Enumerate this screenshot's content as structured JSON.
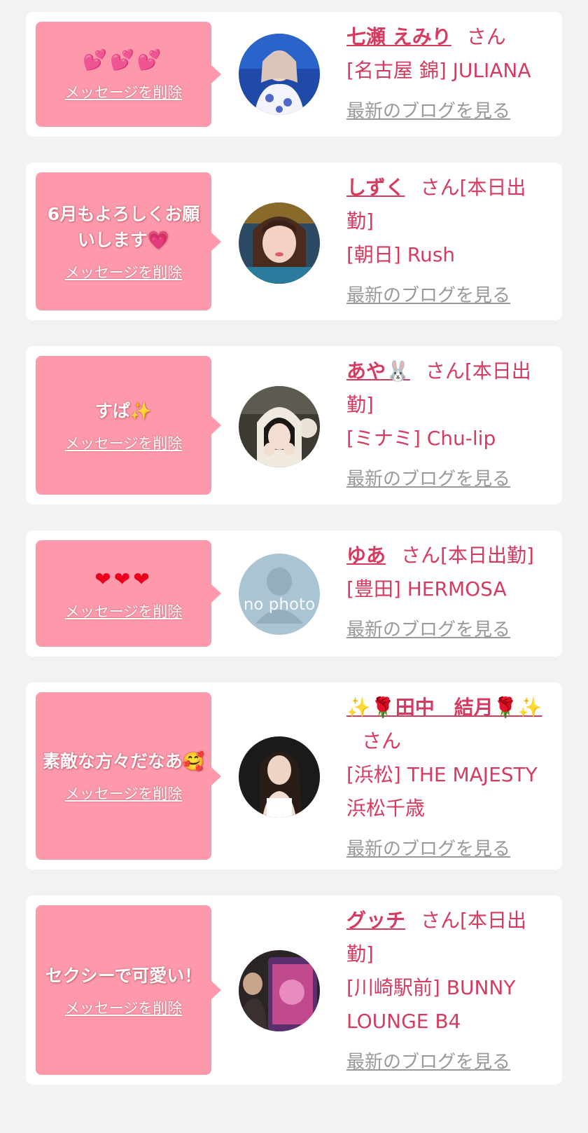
{
  "delete_label": "メッセージを削除",
  "blog_label": "最新のブログを見る",
  "items": [
    {
      "message": "",
      "message_icons": "💕💕💕",
      "name": "七瀬 えみり",
      "suffix": "さん",
      "shop": "[名古屋 錦] JULIANA"
    },
    {
      "message": "6月もよろしくお願いします💗",
      "name": "しずく",
      "suffix": "さん[本日出勤]",
      "shop": "[朝日] Rush"
    },
    {
      "message": "すぱ✨",
      "name": "あや🐰",
      "suffix": "さん[本日出勤]",
      "shop": "[ミナミ] Chu-lip"
    },
    {
      "message": "",
      "message_icons": "❤❤❤",
      "name": "ゆあ",
      "suffix": "さん[本日出勤]",
      "shop": "[豊田] HERMOSA",
      "no_photo_label": "no photo"
    },
    {
      "message": "素敵な方々だなあ🥰",
      "name": "✨🌹田中　結月🌹✨",
      "suffix": "さん",
      "shop": "[浜松] THE MAJESTY 浜松千歳"
    },
    {
      "message": "セクシーで可愛い！",
      "name": "グッチ",
      "suffix": "さん[本日出勤]",
      "shop": "[川崎駅前] BUNNY LOUNGE B4"
    }
  ],
  "colors": {
    "background": "#f2f2f2",
    "card": "#ffffff",
    "bubble": "#fd99aa",
    "accent_text": "#d63a5f",
    "link_gray": "#999999"
  }
}
